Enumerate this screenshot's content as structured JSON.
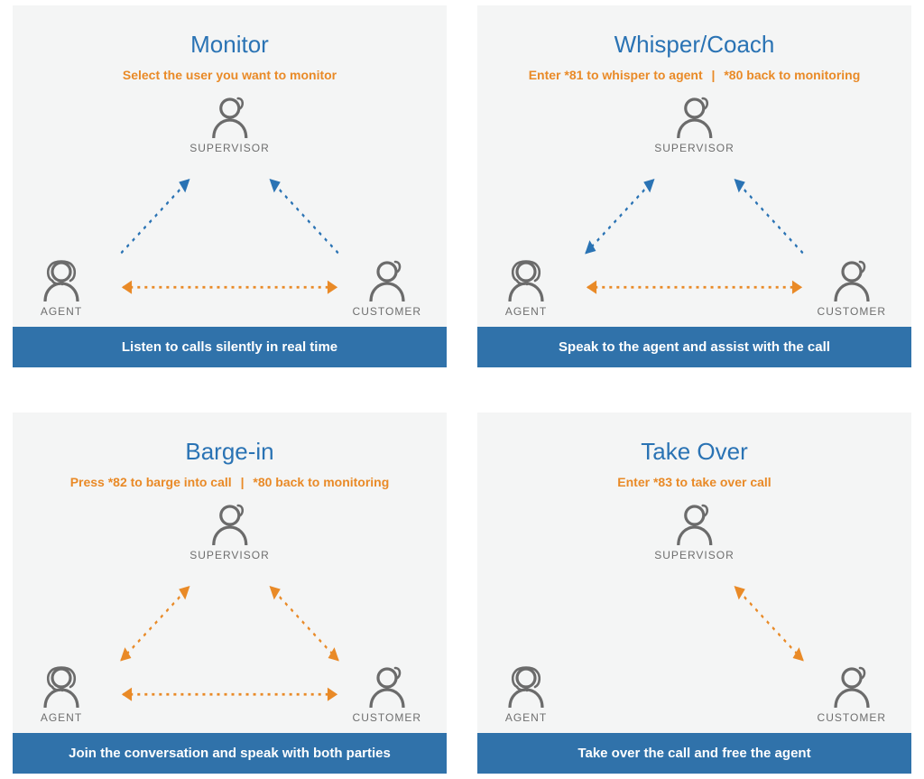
{
  "colors": {
    "blue": "#2a73b4",
    "orange": "#e98a27",
    "gray": "#6e6e6e",
    "icon": "#6b6b6b",
    "footer": "#3072aa"
  },
  "roles": {
    "supervisor": "SUPERVISOR",
    "agent": "AGENT",
    "customer": "CUSTOMER"
  },
  "cards": {
    "monitor": {
      "title": "Monitor",
      "subtitle": "Select the user you want to monitor",
      "footer": "Listen to calls silently in real time",
      "arrows": [
        {
          "from": "agent",
          "to": "supervisor",
          "color": "blue",
          "bidirectional": false
        },
        {
          "from": "customer",
          "to": "supervisor",
          "color": "blue",
          "bidirectional": false
        },
        {
          "from": "agent",
          "to": "customer",
          "color": "orange",
          "bidirectional": true
        }
      ]
    },
    "whisper": {
      "title": "Whisper/Coach",
      "subtitle_a": "Enter *81 to whisper to agent",
      "subtitle_b": "*80 back to monitoring",
      "footer": "Speak to the agent and assist with the call",
      "arrows": [
        {
          "from": "agent",
          "to": "supervisor",
          "color": "blue",
          "bidirectional": true
        },
        {
          "from": "customer",
          "to": "supervisor",
          "color": "blue",
          "bidirectional": false
        },
        {
          "from": "agent",
          "to": "customer",
          "color": "orange",
          "bidirectional": true
        }
      ]
    },
    "barge": {
      "title": "Barge-in",
      "subtitle_a": "Press *82 to barge into call",
      "subtitle_b": "*80 back to monitoring",
      "footer": "Join the conversation and speak with both parties",
      "arrows": [
        {
          "from": "agent",
          "to": "supervisor",
          "color": "orange",
          "bidirectional": true
        },
        {
          "from": "customer",
          "to": "supervisor",
          "color": "orange",
          "bidirectional": true
        },
        {
          "from": "agent",
          "to": "customer",
          "color": "orange",
          "bidirectional": true
        }
      ]
    },
    "takeover": {
      "title": "Take Over",
      "subtitle": "Enter *83 to take over call",
      "footer": "Take over the call and free the agent",
      "arrows": [
        {
          "from": "customer",
          "to": "supervisor",
          "color": "orange",
          "bidirectional": true
        }
      ]
    }
  }
}
